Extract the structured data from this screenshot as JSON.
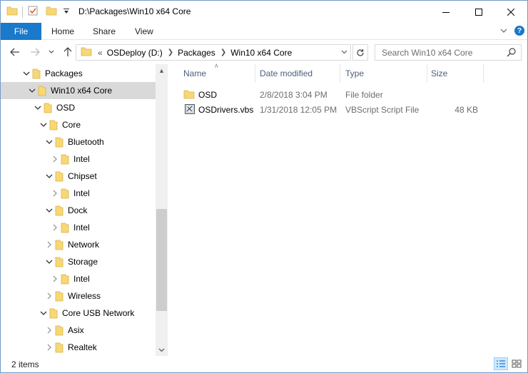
{
  "window": {
    "title": "D:\\Packages\\Win10 x64 Core"
  },
  "ribbon": {
    "tabs": [
      "File",
      "Home",
      "Share",
      "View"
    ]
  },
  "address": {
    "overflow": "«",
    "crumbs": [
      "OSDeploy (D:)",
      "Packages",
      "Win10 x64 Core"
    ]
  },
  "search": {
    "placeholder": "Search Win10 x64 Core"
  },
  "tree": [
    {
      "label": "Packages",
      "expanded": true,
      "selected": false
    },
    {
      "label": "Win10 x64 Core",
      "expanded": true,
      "selected": true
    },
    {
      "label": "OSD",
      "expanded": true,
      "selected": false
    },
    {
      "label": "Core",
      "expanded": true,
      "selected": false
    },
    {
      "label": "Bluetooth",
      "expanded": true,
      "selected": false
    },
    {
      "label": "Intel",
      "expanded": false,
      "selected": false
    },
    {
      "label": "Chipset",
      "expanded": true,
      "selected": false
    },
    {
      "label": "Intel",
      "expanded": false,
      "selected": false
    },
    {
      "label": "Dock",
      "expanded": true,
      "selected": false
    },
    {
      "label": "Intel",
      "expanded": false,
      "selected": false
    },
    {
      "label": "Network",
      "expanded": false,
      "selected": false
    },
    {
      "label": "Storage",
      "expanded": true,
      "selected": false
    },
    {
      "label": "Intel",
      "expanded": false,
      "selected": false
    },
    {
      "label": "Wireless",
      "expanded": false,
      "selected": false
    },
    {
      "label": "Core USB Network",
      "expanded": true,
      "selected": false
    },
    {
      "label": "Asix",
      "expanded": false,
      "selected": false
    },
    {
      "label": "Realtek",
      "expanded": false,
      "selected": false
    }
  ],
  "columns": [
    "Name",
    "Date modified",
    "Type",
    "Size"
  ],
  "files": [
    {
      "icon": "folder-icon",
      "name": "OSD",
      "date": "2/8/2018 3:04 PM",
      "type": "File folder",
      "size": ""
    },
    {
      "icon": "vbscript-file-icon",
      "name": "OSDrivers.vbs",
      "date": "1/31/2018 12:05 PM",
      "type": "VBScript Script File",
      "size": "48 KB"
    }
  ],
  "status": {
    "count": "2 items"
  },
  "colors": {
    "accent": "#1979ca",
    "folder": "#f8d775",
    "selection": "#d9d9d9"
  }
}
